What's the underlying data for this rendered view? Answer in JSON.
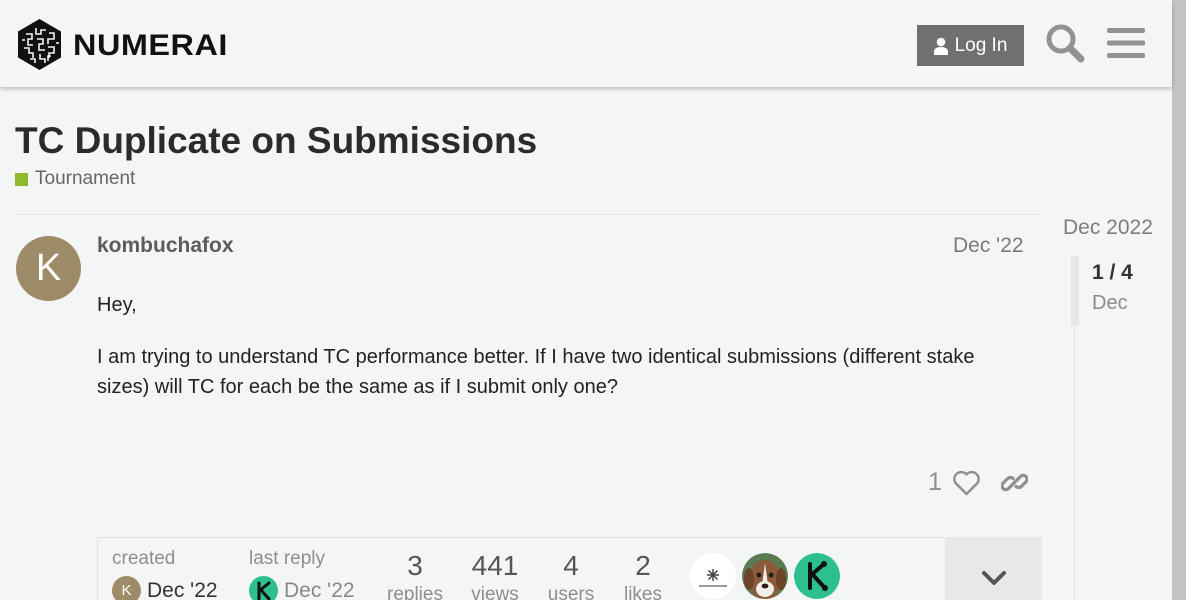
{
  "header": {
    "logo_text": "NUMERAI",
    "login_label": "Log In",
    "search_icon": "search-icon",
    "menu_icon": "hamburger-menu-icon"
  },
  "topic": {
    "title": "TC Duplicate on Submissions",
    "category": "Tournament",
    "category_color": "#8fba2e"
  },
  "post": {
    "avatar_letter": "K",
    "avatar_color": "#9e8b67",
    "username": "kombuchafox",
    "date": "Dec '22",
    "paragraphs": [
      "Hey,",
      "I am trying to understand TC performance better. If I have two identical submissions (different stake sizes) will TC for each be the same as if I submit only one?"
    ],
    "like_count": "1",
    "like_icon": "heart-icon",
    "share_icon": "link-icon"
  },
  "topic_map": {
    "created_label": "created",
    "created_avatar_letter": "K",
    "created_date": "Dec '22",
    "last_reply_label": "last reply",
    "last_reply_date": "Dec '22",
    "stats": [
      {
        "value": "3",
        "label": "replies"
      },
      {
        "value": "441",
        "label": "views"
      },
      {
        "value": "4",
        "label": "users"
      },
      {
        "value": "2",
        "label": "likes"
      }
    ],
    "expand_icon": "chevron-down-icon"
  },
  "timeline": {
    "start_date": "Dec 2022",
    "position": "1 / 4",
    "current_date": "Dec"
  }
}
